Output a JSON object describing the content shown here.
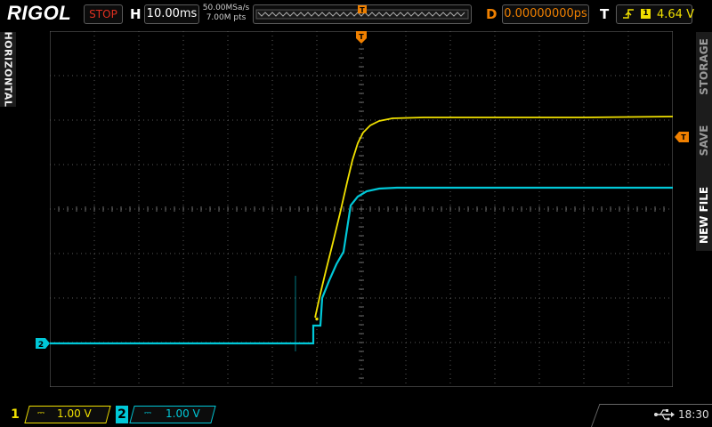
{
  "header": {
    "brand": "RIGOL",
    "run_state": "STOP",
    "horizontal_label": "H",
    "timebase": "10.00ms",
    "sample_rate": "50.00MSa/s",
    "memory_depth": "7.00M pts",
    "trigger_marker": "T",
    "delay_label": "D",
    "delay_value": "0.00000000ps",
    "trigger_label": "T",
    "trigger_source": "1",
    "trigger_level": "4.64 V"
  },
  "side": {
    "left_tab": "HORIZONTAL",
    "right_tabs": [
      "STORAGE",
      "SAVE",
      "NEW FILE"
    ]
  },
  "markers": {
    "trigger_level_marker": "T",
    "ch2_ground_marker": "2"
  },
  "channels": [
    {
      "number": "1",
      "coupling": "⎓",
      "scale": "1.00 V",
      "color": "#f0e000"
    },
    {
      "number": "2",
      "coupling": "⎓",
      "scale": "1.00 V",
      "color": "#00c8d8"
    }
  ],
  "status": {
    "clock": "18:30"
  },
  "colors": {
    "ch1": "#f0e000",
    "ch2": "#00c8d8",
    "accent": "#f08000",
    "stop": "#e03020"
  }
}
